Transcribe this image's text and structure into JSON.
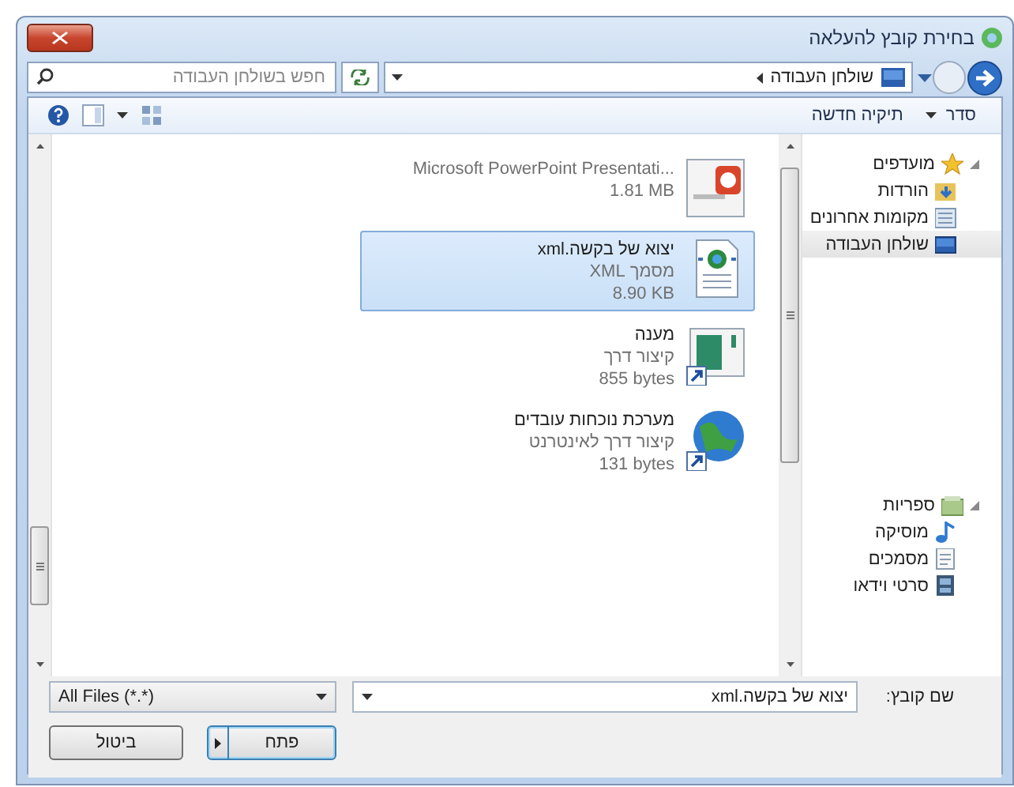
{
  "window": {
    "title": "בחירת קובץ להעלאה"
  },
  "address_bar": {
    "path": "שולחן העבודה",
    "search_placeholder": "חפש בשולחן העבודה"
  },
  "toolbar": {
    "organize": "סדר",
    "new_folder": "תיקיה חדשה"
  },
  "navigation": [
    {
      "label": "מועדפים",
      "kind": "favorites",
      "expanded": true,
      "selected": false,
      "children": [
        {
          "label": "הורדות",
          "kind": "downloads",
          "selected": false
        },
        {
          "label": "מקומות אחרונים",
          "kind": "recent",
          "selected": false
        },
        {
          "label": "שולחן העבודה",
          "kind": "desktop",
          "selected": true
        }
      ]
    },
    {
      "label": "ספריות",
      "kind": "libraries",
      "expanded": true,
      "selected": false,
      "children": [
        {
          "label": "מוסיקה",
          "kind": "music",
          "selected": false
        },
        {
          "label": "מסמכים",
          "kind": "documents",
          "selected": false
        },
        {
          "label": "סרטי וידאו",
          "kind": "videos",
          "selected": false
        }
      ]
    }
  ],
  "files": [
    {
      "kind": "powerpoint",
      "type": "Microsoft PowerPoint Presentati...",
      "size": "1.81 MB",
      "selected": false
    },
    {
      "kind": "xml",
      "name": "יצוא של בקשה.xml",
      "type": "מסמך XML",
      "size": "8.90 KB",
      "selected": true
    },
    {
      "kind": "shortcut",
      "name": "מענה",
      "type": "קיצור דרך",
      "size": "855 bytes",
      "selected": false
    },
    {
      "kind": "internet-shortcut",
      "name": "מערכת נוכחות עובדים",
      "type": "קיצור דרך לאינטרנט",
      "size": "131 bytes",
      "selected": false
    }
  ],
  "bottom": {
    "filename_label": "שם קובץ:",
    "filename": "יצוא של בקשה.xml",
    "filetype": "All Files (*.*)",
    "buttons": [
      {
        "label": "פתח",
        "kind": "split"
      },
      {
        "label": "ביטול",
        "kind": "plain"
      }
    ]
  }
}
